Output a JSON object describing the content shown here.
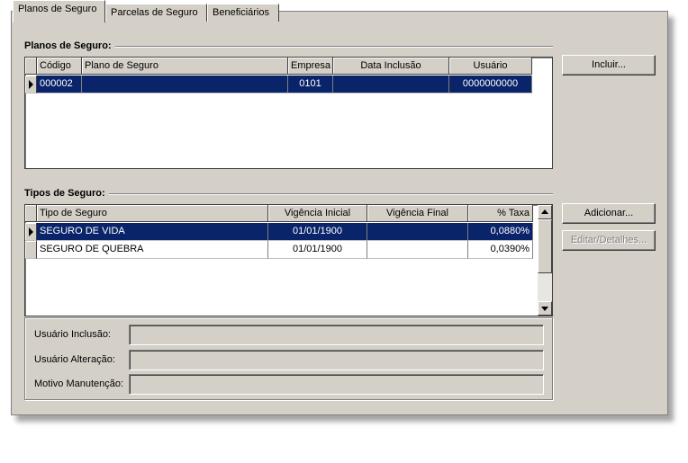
{
  "tabs": [
    {
      "label": "Planos de Seguro"
    },
    {
      "label": "Parcelas de Seguro"
    },
    {
      "label": "Beneficiários"
    }
  ],
  "planos": {
    "section_title": "Planos de Seguro:",
    "columns": [
      "Código",
      "Plano de Seguro",
      "Empresa",
      "Data Inclusão",
      "Usuário"
    ],
    "rows": [
      {
        "codigo": "000002",
        "plano": "",
        "empresa": "0101",
        "data_inclusao": "",
        "usuario": "0000000000"
      }
    ],
    "incluir_label": "Incluir..."
  },
  "tipos": {
    "section_title": "Tipos de Seguro:",
    "columns": [
      "Tipo de Seguro",
      "Vigência Inicial",
      "Vigência Final",
      "% Taxa"
    ],
    "rows": [
      {
        "tipo": "SEGURO DE VIDA",
        "vig_ini": "01/01/1900",
        "vig_fim": "",
        "taxa": "0,0880%"
      },
      {
        "tipo": "SEGURO DE QUEBRA",
        "vig_ini": "01/01/1900",
        "vig_fim": "",
        "taxa": "0,0390%"
      }
    ],
    "adicionar_label": "Adicionar...",
    "editar_label": "Editar/Detalhes..."
  },
  "info": {
    "usuario_inclusao_label": "Usuário Inclusão:",
    "usuario_alteracao_label": "Usuário Alteração:",
    "motivo_label": "Motivo Manutenção:",
    "usuario_inclusao_value": "",
    "usuario_alteracao_value": "",
    "motivo_value": ""
  },
  "colors": {
    "panel": "#d4d0c8",
    "selection": "#0a246a"
  }
}
